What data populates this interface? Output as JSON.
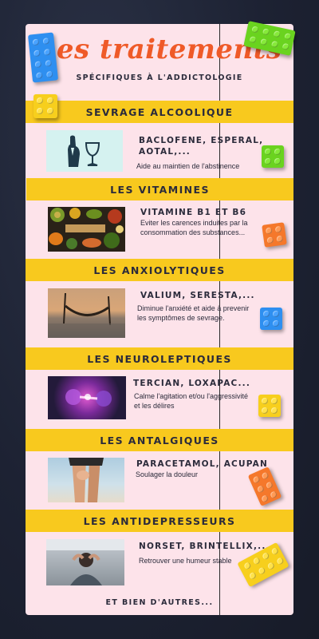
{
  "header": {
    "title": "Les traitements",
    "subtitle": "SPÉCIFIQUES À L'ADDICTOLOGIE"
  },
  "sections": [
    {
      "heading": "SEVRAGE ALCOOLIQUE",
      "drugs": "BACLOFENE, ESPERAL,",
      "drugs_line2": "AOTAL,...",
      "description": "Aide au maintien de l'abstinence",
      "image": "hand-and-wine-glass"
    },
    {
      "heading": "LES VITAMINES",
      "drugs": "VITAMINE B1 ET B6",
      "description_lines": [
        "Eviter les carences induites par la",
        "consommation des substances..."
      ],
      "image": "vitamin-foods"
    },
    {
      "heading": "LES ANXIOLYTIQUES",
      "drugs": "VALIUM, SERESTA,...",
      "description_lines": [
        "Diminue l'anxiété et aide à prevenir",
        "les symptômes de sevrage."
      ],
      "image": "hammock-sunset"
    },
    {
      "heading": "LES NEUROLEPTIQUES",
      "drugs": "TERCIAN, LOXAPAC...",
      "description_lines": [
        "Calme l'agitation et/ou l'aggressivité",
        "et les délires"
      ],
      "image": "neurons"
    },
    {
      "heading": "LES ANTALGIQUES",
      "drugs": "PARACETAMOL, ACUPAN",
      "description": "Soulager la douleur",
      "image": "knee-pain"
    },
    {
      "heading": "LES ANTIDEPRESSEURS",
      "drugs": "NORSET, BRINTELLIX,...",
      "description": "Retrouver une humeur stable",
      "image": "person-head-in-hands"
    }
  ],
  "footer": "ET BIEN D'AUTRES...",
  "colors": {
    "background": "#1d2233",
    "card": "#fde3ea",
    "band": "#f8c91e",
    "title": "#ef5a28",
    "text": "#2b2b3b",
    "brick_blue": "#2e8ff0",
    "brick_green": "#6ad31f",
    "brick_yellow": "#f7cf1d",
    "brick_orange": "#f5782b"
  }
}
